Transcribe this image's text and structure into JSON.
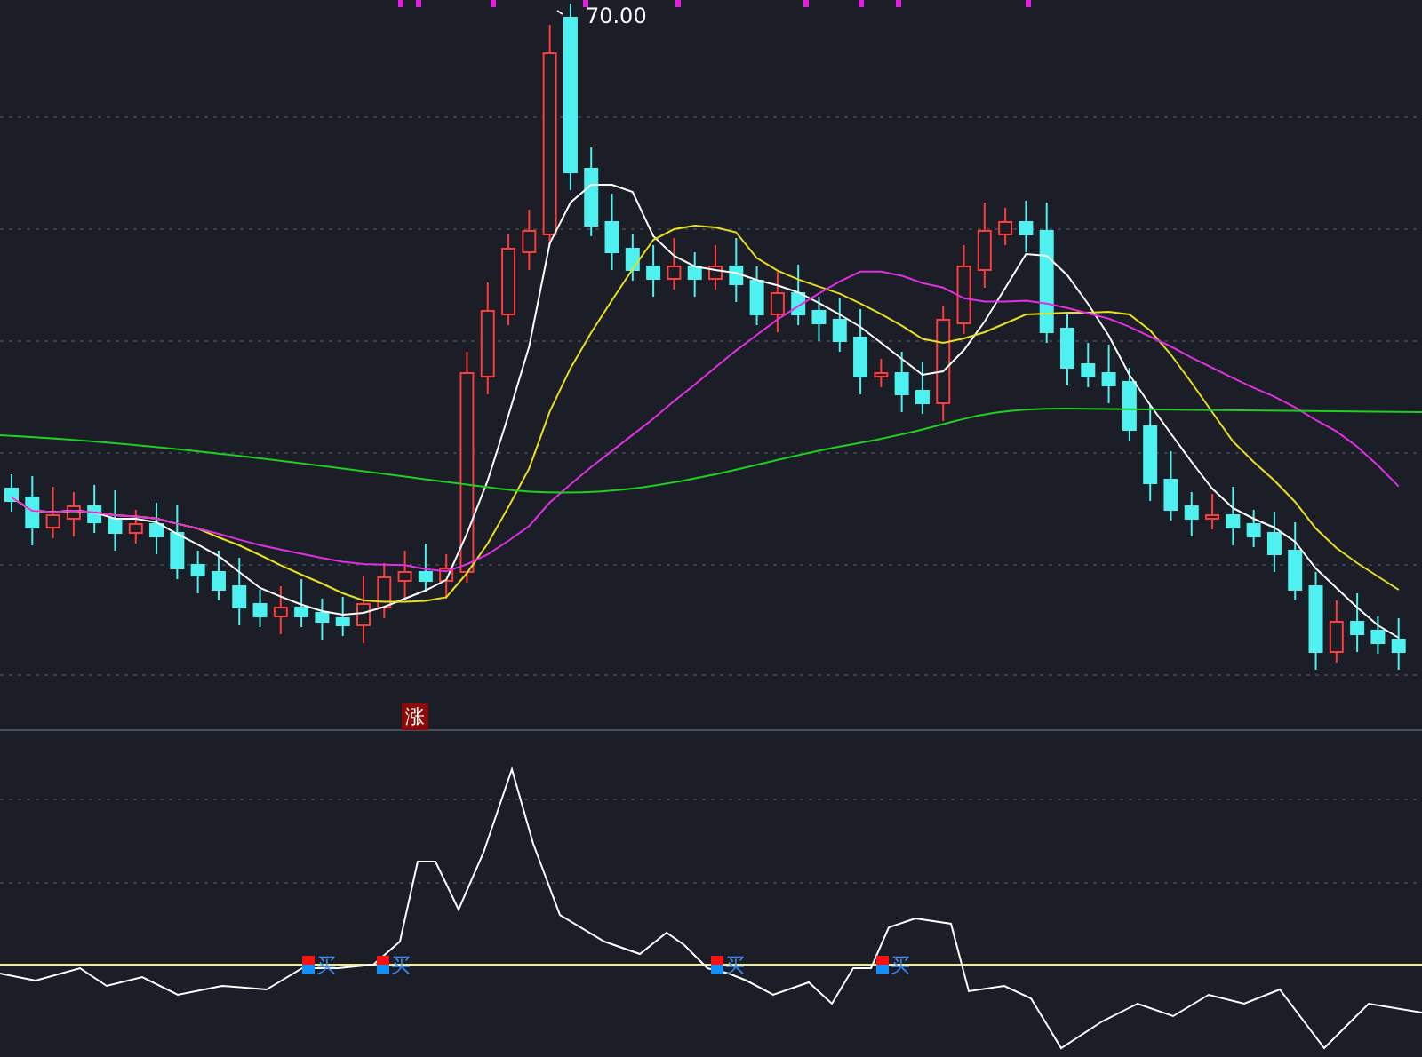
{
  "price_chart": {
    "high_label": "70.00",
    "badge": "涨"
  },
  "indicator": {
    "signals": [
      {
        "text": "买"
      },
      {
        "text": "买"
      },
      {
        "text": "买"
      },
      {
        "text": "买"
      }
    ]
  }
}
